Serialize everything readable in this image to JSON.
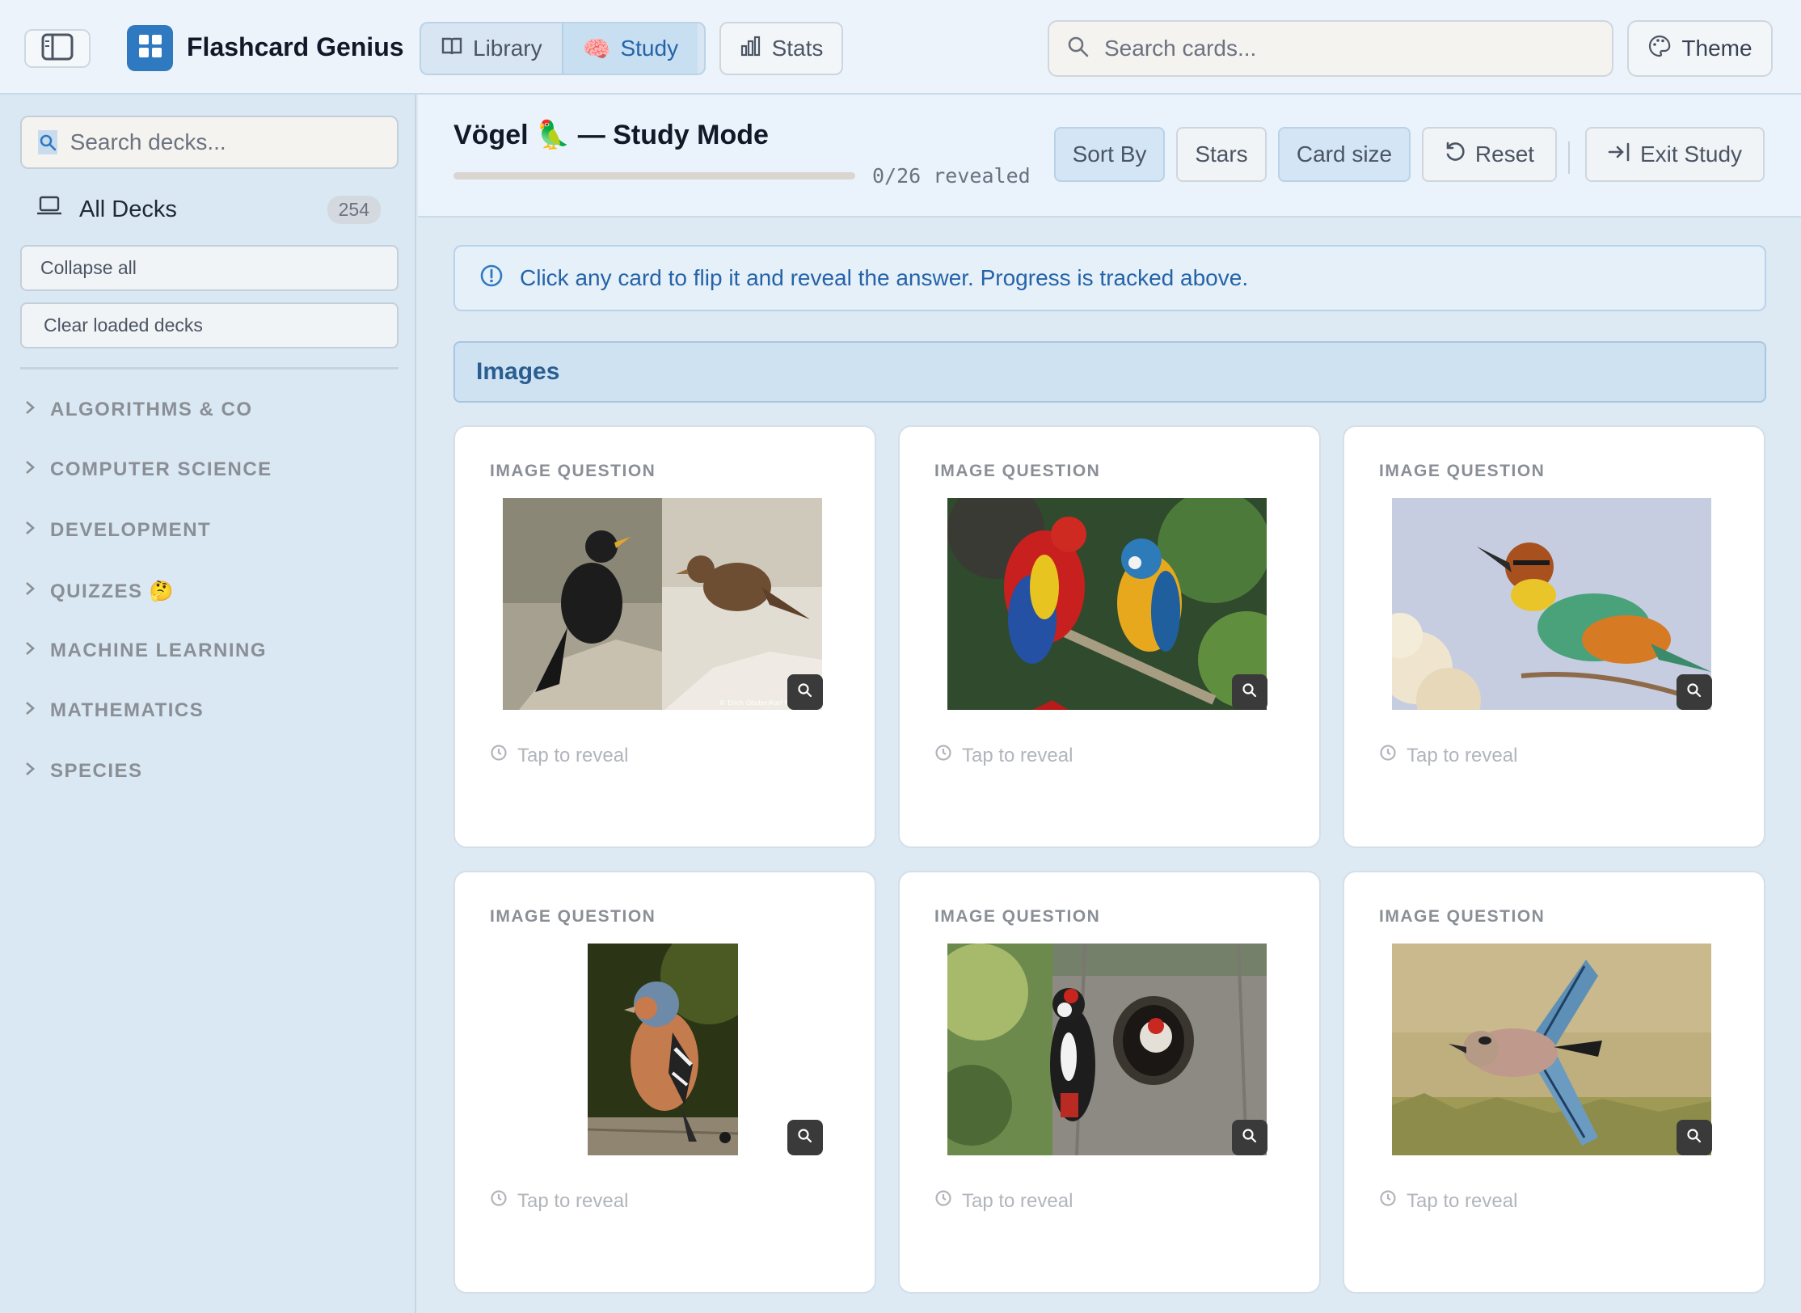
{
  "app": {
    "title": "Flashcard Genius"
  },
  "nav": {
    "library": "Library",
    "study": "Study",
    "study_emoji": "🧠",
    "stats": "Stats"
  },
  "search": {
    "placeholder": "Search cards..."
  },
  "theme": {
    "label": "Theme"
  },
  "sidebar": {
    "search_placeholder": "Search decks...",
    "all_decks": {
      "label": "All Decks",
      "count": "254"
    },
    "collapse_all": "Collapse all",
    "clear_loaded": "Clear loaded decks",
    "categories": [
      {
        "label": "ALGORITHMS & CO"
      },
      {
        "label": "COMPUTER SCIENCE"
      },
      {
        "label": "DEVELOPMENT"
      },
      {
        "label": "QUIZZES 🤔"
      },
      {
        "label": "MACHINE LEARNING"
      },
      {
        "label": "MATHEMATICS"
      },
      {
        "label": "SPECIES"
      }
    ]
  },
  "study": {
    "title": "Vögel 🦜 — Study Mode",
    "progress_text": "0/26 revealed",
    "progress": 0,
    "sort_by": "Sort By",
    "stars": "Stars",
    "card_size": "Card size",
    "reset": "Reset",
    "exit": "Exit Study"
  },
  "info": {
    "text": "Click any card to flip it and reveal the answer. Progress is tracked above."
  },
  "section": {
    "title": "Images"
  },
  "cards": [
    {
      "label": "IMAGE QUESTION",
      "reveal": "Tap to reveal",
      "photo": "blackbird-pair",
      "credit": "© Erich Obster/Karl Roessner"
    },
    {
      "label": "IMAGE QUESTION",
      "reveal": "Tap to reveal",
      "photo": "macaws"
    },
    {
      "label": "IMAGE QUESTION",
      "reveal": "Tap to reveal",
      "photo": "bee-eater"
    },
    {
      "label": "IMAGE QUESTION",
      "reveal": "Tap to reveal",
      "photo": "chaffinch"
    },
    {
      "label": "IMAGE QUESTION",
      "reveal": "Tap to reveal",
      "photo": "woodpecker"
    },
    {
      "label": "IMAGE QUESTION",
      "reveal": "Tap to reveal",
      "photo": "jay"
    }
  ],
  "colors": {
    "accent": "#2f79c0",
    "info_text": "#2563a8",
    "section_text": "#2a5e93"
  }
}
